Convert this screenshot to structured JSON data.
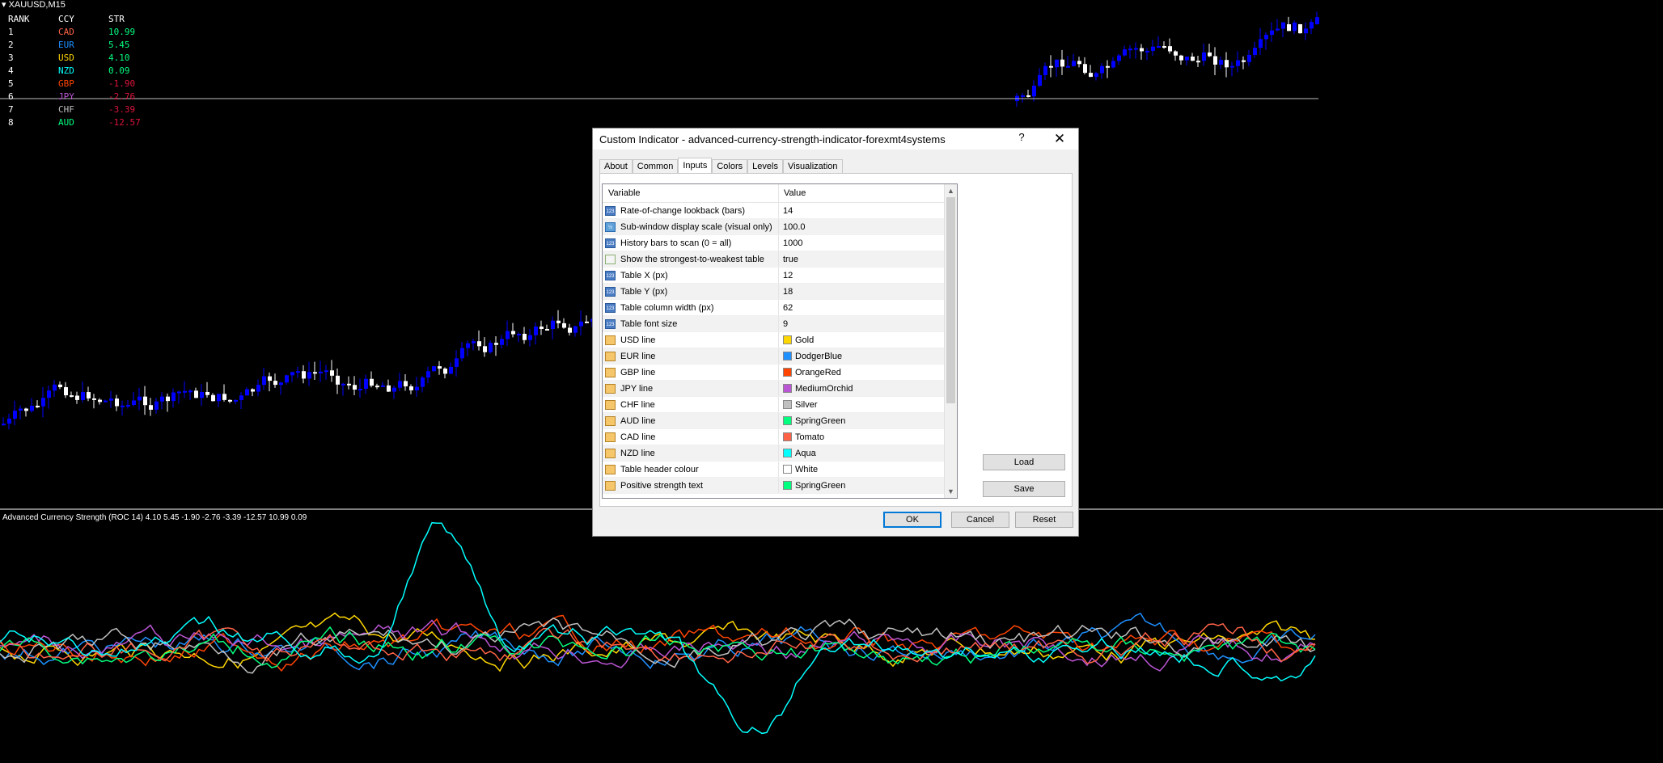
{
  "symbol": "XAUUSD,M15",
  "rank_table": {
    "headers": [
      "RANK",
      "CCY",
      "STR"
    ],
    "rows": [
      {
        "rank": "1",
        "ccy": "CAD",
        "str": "10.99",
        "ccy_color": "#ff6347",
        "str_color": "#00ff7f"
      },
      {
        "rank": "2",
        "ccy": "EUR",
        "str": "5.45",
        "ccy_color": "#1e90ff",
        "str_color": "#00ff7f"
      },
      {
        "rank": "3",
        "ccy": "USD",
        "str": "4.10",
        "ccy_color": "#ffd700",
        "str_color": "#00ff7f"
      },
      {
        "rank": "4",
        "ccy": "NZD",
        "str": "0.09",
        "ccy_color": "#00ffff",
        "str_color": "#00ff7f"
      },
      {
        "rank": "5",
        "ccy": "GBP",
        "str": "-1.90",
        "ccy_color": "#ff4500",
        "str_color": "#dc143c"
      },
      {
        "rank": "6",
        "ccy": "JPY",
        "str": "-2.76",
        "ccy_color": "#ba55d3",
        "str_color": "#dc143c"
      },
      {
        "rank": "7",
        "ccy": "CHF",
        "str": "-3.39",
        "ccy_color": "#c0c0c0",
        "str_color": "#dc143c"
      },
      {
        "rank": "8",
        "ccy": "AUD",
        "str": "-12.57",
        "ccy_color": "#00ff7f",
        "str_color": "#dc143c"
      }
    ]
  },
  "subwindow_label": "Advanced Currency Strength (ROC 14) 4.10 5.45 -1.90 -2.76 -3.39 -12.57 10.99 0.09",
  "dialog": {
    "title": "Custom Indicator - advanced-currency-strength-indicator-forexmt4systems",
    "help": "?",
    "close": "✕",
    "tabs": [
      "About",
      "Common",
      "Inputs",
      "Colors",
      "Levels",
      "Visualization"
    ],
    "active_tab": "Inputs",
    "grid_headers": {
      "variable": "Variable",
      "value": "Value"
    },
    "rows": [
      {
        "icon": "integer-icon",
        "label": "Rate-of-change lookback (bars)",
        "value": "14"
      },
      {
        "icon": "double-icon",
        "label": "Sub-window display scale (visual only)",
        "value": "100.0"
      },
      {
        "icon": "integer-icon",
        "label": "History bars to scan (0 = all)",
        "value": "1000"
      },
      {
        "icon": "bool-icon",
        "label": "Show the strongest-to-weakest table",
        "value": "true"
      },
      {
        "icon": "integer-icon",
        "label": "Table X (px)",
        "value": "12"
      },
      {
        "icon": "integer-icon",
        "label": "Table Y (px)",
        "value": "18"
      },
      {
        "icon": "integer-icon",
        "label": "Table column width (px)",
        "value": "62"
      },
      {
        "icon": "integer-icon",
        "label": "Table font size",
        "value": "9"
      },
      {
        "icon": "color-icon",
        "label": "USD line",
        "value": "Gold",
        "swatch": "#ffd700"
      },
      {
        "icon": "color-icon",
        "label": "EUR line",
        "value": "DodgerBlue",
        "swatch": "#1e90ff"
      },
      {
        "icon": "color-icon",
        "label": "GBP line",
        "value": "OrangeRed",
        "swatch": "#ff4500"
      },
      {
        "icon": "color-icon",
        "label": "JPY line",
        "value": "MediumOrchid",
        "swatch": "#ba55d3"
      },
      {
        "icon": "color-icon",
        "label": "CHF line",
        "value": "Silver",
        "swatch": "#c0c0c0"
      },
      {
        "icon": "color-icon",
        "label": "AUD line",
        "value": "SpringGreen",
        "swatch": "#00ff7f"
      },
      {
        "icon": "color-icon",
        "label": "CAD line",
        "value": "Tomato",
        "swatch": "#ff6347"
      },
      {
        "icon": "color-icon",
        "label": "NZD line",
        "value": "Aqua",
        "swatch": "#00ffff"
      },
      {
        "icon": "color-icon",
        "label": "Table header colour",
        "value": "White",
        "swatch": "#ffffff"
      },
      {
        "icon": "color-icon",
        "label": "Positive strength text",
        "value": "SpringGreen",
        "swatch": "#00ff7f"
      }
    ],
    "buttons": {
      "load": "Load",
      "save": "Save",
      "ok": "OK",
      "cancel": "Cancel",
      "reset": "Reset"
    }
  },
  "colors": {
    "bull_candle": "#0000ff",
    "bear_candle": "#ffffff",
    "background": "#000000"
  }
}
